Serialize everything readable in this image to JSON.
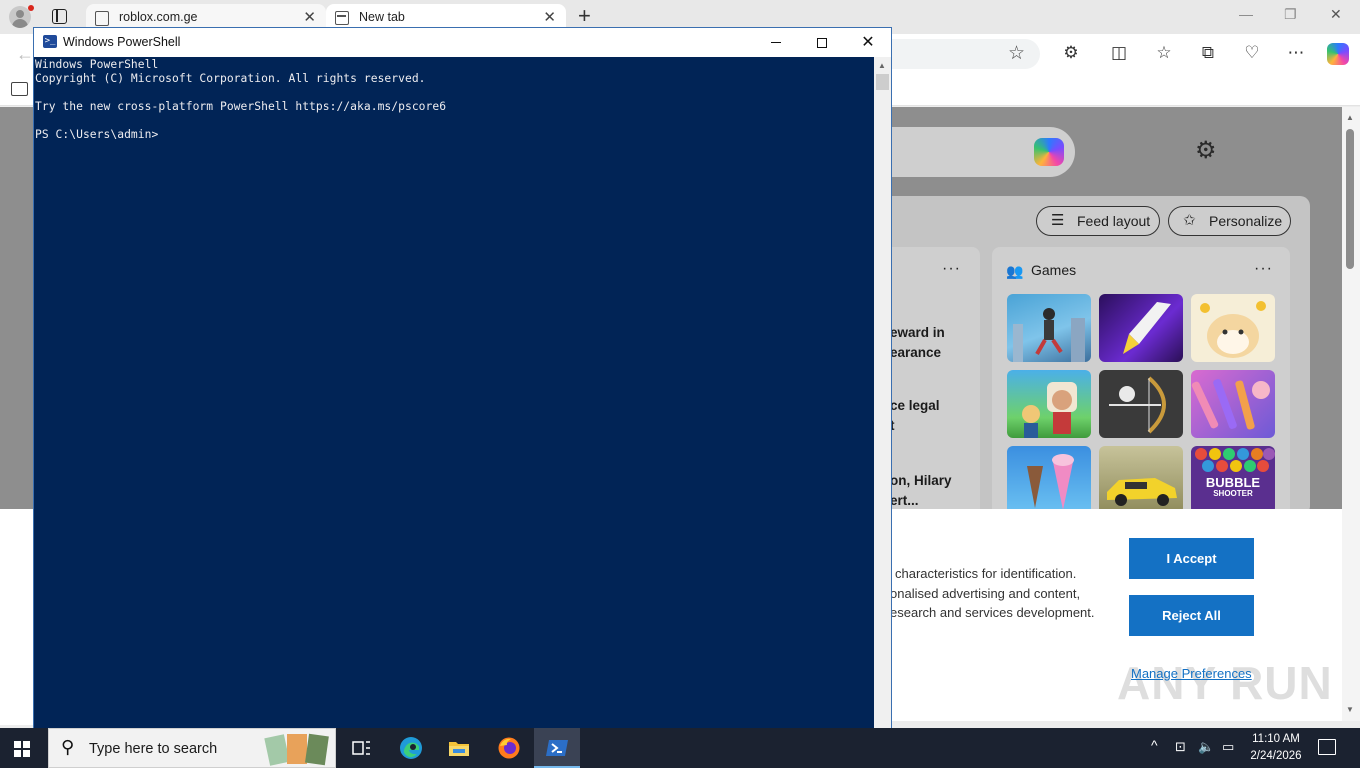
{
  "browser": {
    "tabs": [
      {
        "title": "roblox.com.ge"
      },
      {
        "title": "New tab"
      }
    ],
    "tab_close_glyph": "✕",
    "new_tab_glyph": "+",
    "window_controls": {
      "minimize": "—",
      "restore": "❐",
      "close": "✕"
    },
    "back_glyph": "←"
  },
  "newtab_page": {
    "feed_layout_label": "Feed layout",
    "personalize_label": "Personalize",
    "games_title": "Games",
    "more_glyph": "···",
    "news_snippets": [
      {
        "line1": "eward in",
        "line2": "earance"
      },
      {
        "line1": "ce legal",
        "line2": "t"
      },
      {
        "line1": "on, Hilary",
        "line2": "ert..."
      }
    ],
    "bubble_shooter_text": "BUBBLE",
    "bubble_shooter_sub": "SHOOTER"
  },
  "cookie_banner": {
    "heading_fragment": ":",
    "lines": [
      "characteristics for identification.",
      "onalised advertising and content,",
      "esearch and services development."
    ],
    "accept_label": "I Accept",
    "reject_label": "Reject All",
    "manage_label": "Manage Preferences",
    "watermark_text": "ANY RUN",
    "accent_color": "#1471c4"
  },
  "powershell": {
    "window_title": "Windows PowerShell",
    "icon_glyph": ">_",
    "console_lines": [
      "Windows PowerShell",
      "Copyright (C) Microsoft Corporation. All rights reserved.",
      "",
      "Try the new cross-platform PowerShell https://aka.ms/pscore6",
      "",
      "PS C:\\Users\\admin>"
    ],
    "background_color": "#012456",
    "close_glyph": "✕"
  },
  "taskbar": {
    "search_placeholder": "Type here to search",
    "clock_time": "11:10 AM",
    "clock_date": "2/24/2026",
    "pinned_apps": [
      "task-view",
      "edge",
      "file-explorer",
      "firefox",
      "powershell"
    ]
  }
}
